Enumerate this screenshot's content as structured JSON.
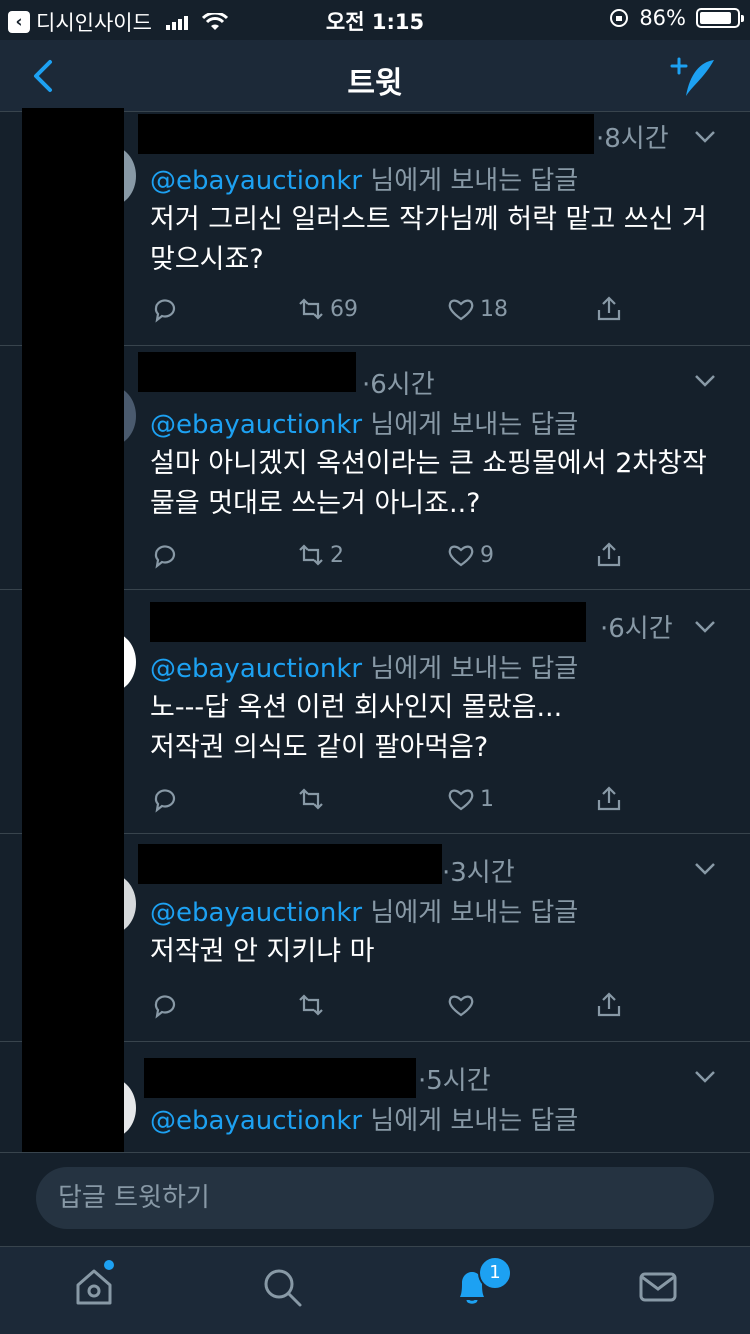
{
  "status_bar": {
    "back_app_label": "디시인사이드",
    "time": "오전 1:15",
    "battery_percent": "86%",
    "battery_level": 0.86
  },
  "nav": {
    "title": "트윗"
  },
  "reply_prefix": "@ebayauctionkr",
  "reply_suffix": " 님에게 보내는 답글",
  "tweets": [
    {
      "time": "·8시간",
      "text": "저거 그리신 일러스트 작가님께 허락 맡고 쓰신 거\n맞으시죠?",
      "retweets": "69",
      "likes": "18"
    },
    {
      "time": "·6시간",
      "text": "설마 아니겠지 옥션이라는 큰 쇼핑몰에서 2차창작\n물을 멋대로 쓰는거 아니죠..?",
      "retweets": "2",
      "likes": "9"
    },
    {
      "time": "·6시간",
      "text": "노---답 옥션 이런 회사인지 몰랐음...\n저작권 의식도 같이 팔아먹음?",
      "retweets": "",
      "likes": "1"
    },
    {
      "time": "·3시간",
      "text": "저작권 안 지키냐 마",
      "retweets": "",
      "likes": ""
    },
    {
      "time": "·5시간",
      "text": "",
      "retweets": "",
      "likes": ""
    }
  ],
  "reply_bar": {
    "placeholder": "답글 트윗하기"
  },
  "tab_bar": {
    "notifications_badge": "1"
  }
}
